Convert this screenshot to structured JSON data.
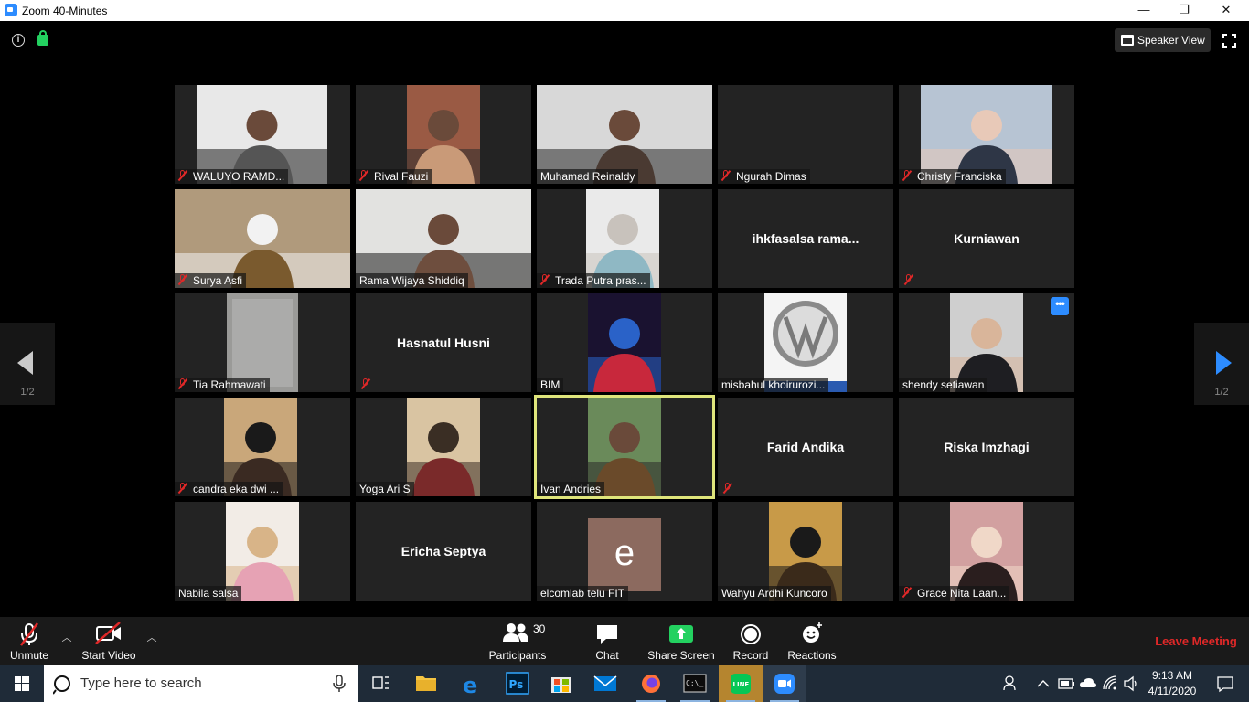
{
  "window": {
    "title": "Zoom 40-Minutes",
    "minimize": "—",
    "restore": "❐",
    "close": "✕"
  },
  "top_bar": {
    "speaker_view_label": "Speaker View"
  },
  "paging": {
    "prev_page_label": "1/2",
    "next_page_label": "1/2"
  },
  "participants": [
    {
      "name": "WALUYO RAMD...",
      "muted": true,
      "video": "photo-bw",
      "colors": [
        "#e8e8e8",
        "#555555",
        "#1e1e1e"
      ]
    },
    {
      "name": "Rival Fauzi",
      "muted": true,
      "video": "photo",
      "colors": [
        "#9a5a44",
        "#c99a78",
        "#2b2b2b"
      ]
    },
    {
      "name": "Muhamad Reinaldy",
      "muted": false,
      "video": "camera",
      "colors": [
        "#d8d8d8",
        "#4a3a32",
        "#2a2a2a"
      ]
    },
    {
      "name": "Ngurah Dimas",
      "muted": true,
      "video": "none",
      "colors": []
    },
    {
      "name": "Christy Franciska",
      "muted": true,
      "video": "photo",
      "colors": [
        "#b7c4d3",
        "#2e3646",
        "#e8c9b8"
      ]
    },
    {
      "name": "Surya Asfi",
      "muted": true,
      "video": "camera",
      "colors": [
        "#b09a7c",
        "#7a5a2e",
        "#f2f2f2"
      ]
    },
    {
      "name": "Rama Wijaya Shiddiq",
      "muted": false,
      "video": "camera",
      "colors": [
        "#e2e2e0",
        "#6e4e3e",
        "#1e1e1e"
      ]
    },
    {
      "name": "Trada Putra pras...",
      "muted": true,
      "video": "camera",
      "colors": [
        "#eaeaea",
        "#8fb8c4",
        "#c8c2bc"
      ]
    },
    {
      "name": "ihkfasalsa  rama...",
      "muted": false,
      "video": "none-center",
      "colors": []
    },
    {
      "name": "Kurniawan",
      "muted": true,
      "video": "none-center",
      "colors": []
    },
    {
      "name": "Tia Rahmawati",
      "muted": true,
      "video": "photo-blur",
      "colors": [
        "#9a9a98",
        "#b8b8b6"
      ]
    },
    {
      "name": "Hasnatul Husni",
      "muted": true,
      "video": "none-center",
      "colors": []
    },
    {
      "name": "BIM",
      "muted": false,
      "video": "photo",
      "colors": [
        "#1a1230",
        "#c8283c",
        "#2a62c8"
      ]
    },
    {
      "name": "misbahul khoirurozi...",
      "muted": false,
      "video": "photo-vw",
      "colors": [
        "#f4f4f4",
        "#8a8a8a",
        "#2a5ab0"
      ]
    },
    {
      "name": "shendy setiawan",
      "muted": false,
      "video": "photo",
      "colors": [
        "#cfcfcf",
        "#1e1e22",
        "#d9b59a"
      ],
      "more_menu": "•••"
    },
    {
      "name": "candra eka dwi ...",
      "muted": true,
      "video": "camera",
      "colors": [
        "#c9a77a",
        "#3a2a22",
        "#1a1a1a"
      ]
    },
    {
      "name": "Yoga Ari S",
      "muted": false,
      "video": "photo",
      "colors": [
        "#d9c4a2",
        "#7a2a2a",
        "#3a2e24"
      ]
    },
    {
      "name": "Ivan Andries",
      "muted": false,
      "video": "photo",
      "colors": [
        "#6a8a5a",
        "#6a4a2a",
        "#2a2a2a"
      ],
      "active_speaker": true
    },
    {
      "name": "Farid Andika",
      "muted": true,
      "video": "none-center",
      "colors": []
    },
    {
      "name": "Riska Imzhagi",
      "muted": false,
      "video": "none-center",
      "colors": []
    },
    {
      "name": "Nabila salsa",
      "muted": false,
      "video": "photo",
      "colors": [
        "#f2ece6",
        "#e6a2b4",
        "#d8b488"
      ]
    },
    {
      "name": "Ericha Septya",
      "muted": false,
      "video": "none-center",
      "colors": []
    },
    {
      "name": "elcomlab telu FIT",
      "muted": false,
      "video": "letter",
      "letter": "e",
      "colors": [
        "#8c6a5f"
      ]
    },
    {
      "name": "Wahyu Ardhi Kuncoro",
      "muted": false,
      "video": "photo",
      "colors": [
        "#c89a48",
        "#3a2a1a",
        "#1a1a1a"
      ]
    },
    {
      "name": "Grace Nita Laan...",
      "muted": true,
      "video": "photo",
      "colors": [
        "#d2a0a0",
        "#2a1e1e",
        "#f0d8c8"
      ]
    }
  ],
  "toolbar": {
    "unmute_label": "Unmute",
    "start_video_label": "Start Video",
    "participants_label": "Participants",
    "participants_count": "30",
    "chat_label": "Chat",
    "share_screen_label": "Share Screen",
    "record_label": "Record",
    "reactions_label": "Reactions",
    "leave_label": "Leave Meeting",
    "caret_glyph": "︿"
  },
  "taskbar": {
    "search_placeholder": "Type here to search",
    "time": "9:13 AM",
    "date": "4/11/2020"
  },
  "colors": {
    "zoom_blue": "#2d8cff",
    "muted_red": "#e02828",
    "active_speaker_border": "#dfe57b",
    "share_green": "#23d160",
    "tile_bg": "#232323",
    "taskbar_bg": "#1f2b38"
  }
}
